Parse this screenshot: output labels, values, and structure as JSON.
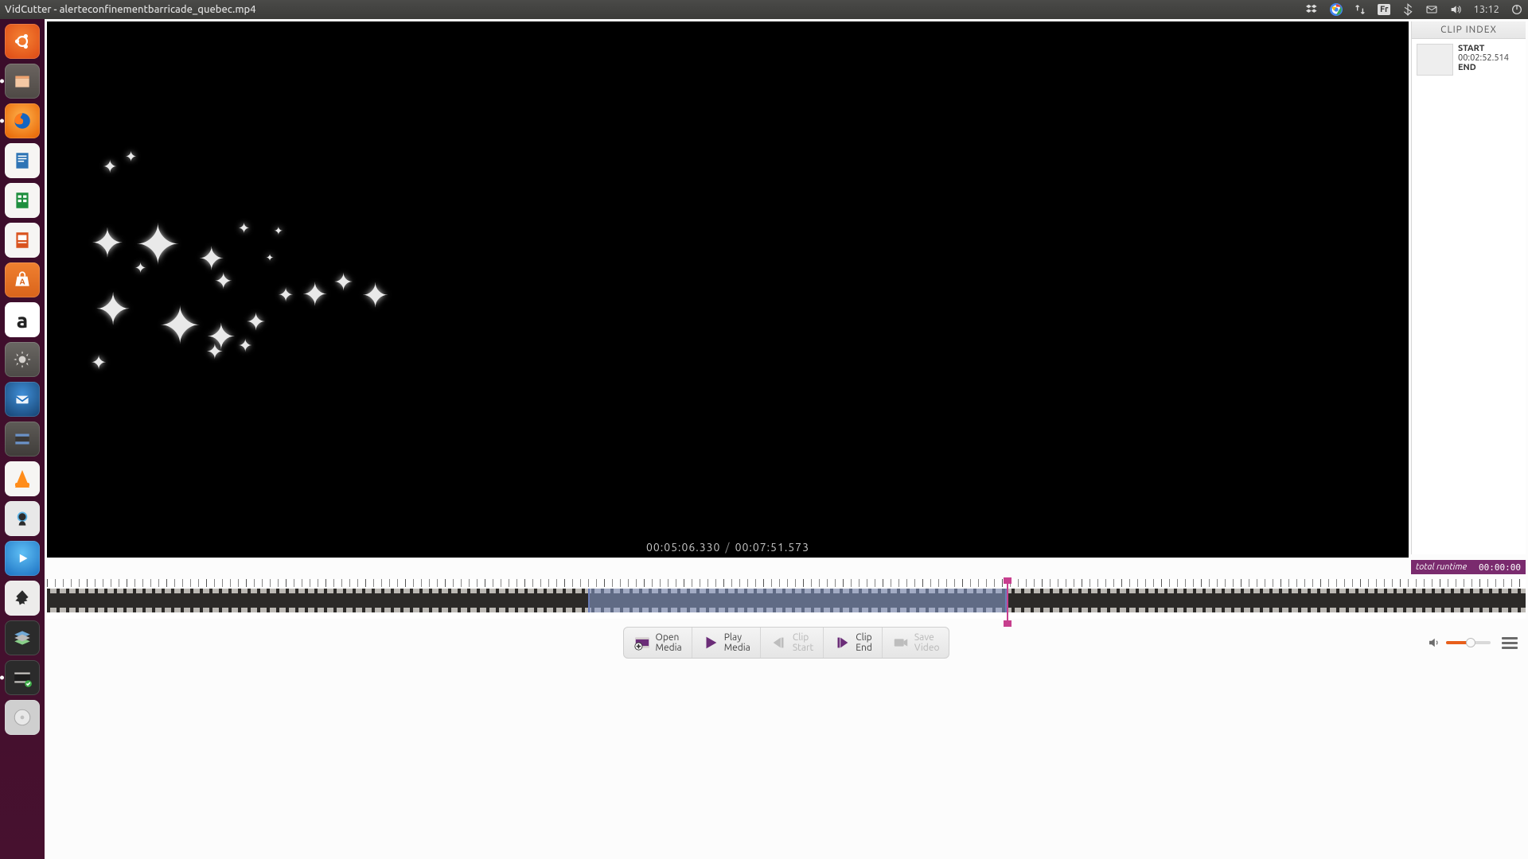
{
  "menubar": {
    "title": "VidCutter - alerteconfinementbarricade_quebec.mp4",
    "lang": "Fr",
    "clock": "13:12"
  },
  "launcher": [
    {
      "name": "dash",
      "letter": ""
    },
    {
      "name": "files",
      "letter": ""
    },
    {
      "name": "firefox",
      "letter": ""
    },
    {
      "name": "writer",
      "letter": ""
    },
    {
      "name": "calc",
      "letter": ""
    },
    {
      "name": "impress",
      "letter": ""
    },
    {
      "name": "software",
      "letter": ""
    },
    {
      "name": "amazon",
      "letter": "a"
    },
    {
      "name": "settings",
      "letter": ""
    },
    {
      "name": "thunderbird",
      "letter": ""
    },
    {
      "name": "video-editor",
      "letter": ""
    },
    {
      "name": "vlc",
      "letter": ""
    },
    {
      "name": "kazam",
      "letter": ""
    },
    {
      "name": "media-player",
      "letter": ""
    },
    {
      "name": "inkscape",
      "letter": ""
    },
    {
      "name": "layers",
      "letter": ""
    },
    {
      "name": "vidcutter",
      "letter": ""
    },
    {
      "name": "disc",
      "letter": ""
    }
  ],
  "preview": {
    "current_time": "00:05:06.330",
    "total_time": "00:07:51.573"
  },
  "clip_index": {
    "title": "CLIP INDEX",
    "items": [
      {
        "start_label": "START",
        "start": "00:02:52.514",
        "end_label": "END",
        "end": ""
      }
    ]
  },
  "runtime": {
    "label": "total runtime",
    "value": "00:00:00"
  },
  "timeline": {
    "selection_start_pct": 36.6,
    "selection_end_pct": 64.9,
    "playhead_pct": 64.9
  },
  "controls": {
    "open": {
      "l1": "Open",
      "l2": "Media"
    },
    "play": {
      "l1": "Play",
      "l2": "Media"
    },
    "clip_start": {
      "l1": "Clip",
      "l2": "Start"
    },
    "clip_end": {
      "l1": "Clip",
      "l2": "End"
    },
    "save": {
      "l1": "Save",
      "l2": "Video"
    },
    "volume_pct": 55
  }
}
